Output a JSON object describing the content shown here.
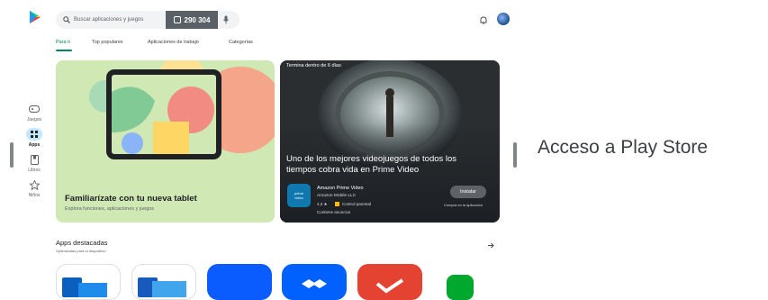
{
  "search": {
    "placeholder": "Buscar aplicaciones y juegos"
  },
  "counter": {
    "value": "290 304"
  },
  "rail": [
    {
      "label": "Juegos",
      "icon": "gamepad-icon"
    },
    {
      "label": "Apps",
      "icon": "apps-grid-icon",
      "active": true
    },
    {
      "label": "Libros",
      "icon": "book-icon"
    },
    {
      "label": "Niños",
      "icon": "star-icon"
    }
  ],
  "tabs": [
    {
      "label": "Para ti",
      "active": true
    },
    {
      "label": "Top populares"
    },
    {
      "label": "Aplicaciones de trabajo"
    },
    {
      "label": "Categorías"
    }
  ],
  "promo": {
    "title": "Familiarízate con tu nueva tablet",
    "subtitle": "Explora funciones, aplicaciones y juegos"
  },
  "hero": {
    "tag": "Termina dentro de 6 días",
    "title": "Uno de los mejores videojuegos de todos los tiempos cobra vida en Prime Video",
    "app_icon_text": "prime video",
    "app_name": "Amazon Prime Video",
    "developer": "Amazon Mobile LLC",
    "rating": "4,3 ★",
    "parental": "Control parental",
    "ads": "Contiene anuncios",
    "install_label": "Instalar",
    "install_hint": "Compra en la aplicación"
  },
  "featured": {
    "title": "Apps destacadas",
    "subtitle": "Optimizadas para tu dispositivo"
  },
  "side_label": "Acceso a Play Store",
  "colors": {
    "play_green": "#01875f",
    "promo_bg": "#cfe8b4",
    "hero_bg": "#1c1f24"
  }
}
